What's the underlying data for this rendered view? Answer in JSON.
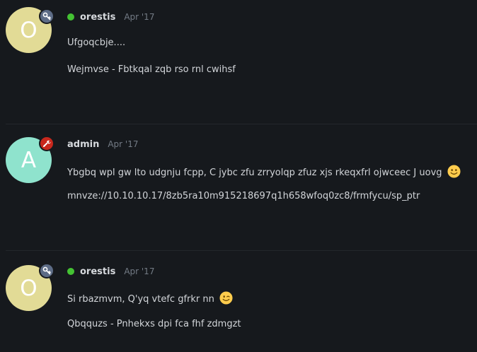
{
  "colors": {
    "background": "#16191d",
    "avatar_o": "#e2db96",
    "avatar_a": "#8fe3cd",
    "moderator_badge": "#5d6c86",
    "admin_badge": "#c8281d",
    "online": "#44c233"
  },
  "posts": [
    {
      "avatar_letter": "O",
      "avatar_color": "#e2db96",
      "badge_icon": "key-icon",
      "online": true,
      "username": "orestis",
      "date": "Apr '17",
      "lines": [
        "Ufgoqcbje....",
        "Wejmvse - Fbtkqal zqb rso rnl cwihsf"
      ]
    },
    {
      "avatar_letter": "A",
      "avatar_color": "#8fe3cd",
      "badge_icon": "wrench-icon",
      "online": false,
      "username": "admin",
      "date": "Apr '17",
      "lines": [
        "Ybgbq wpl gw lto udgnju fcpp, C jybc zfu zrryolqp zfuz xjs rkeqxfrl ojwceec J uovg",
        "mnvze://10.10.10.17/8zb5ra10m915218697q1h658wfoq0zc8/frmfycu/sp_ptr"
      ],
      "emoji": "slightly-smiling-face-icon"
    },
    {
      "avatar_letter": "O",
      "avatar_color": "#e2db96",
      "badge_icon": "key-icon",
      "online": true,
      "username": "orestis",
      "date": "Apr '17",
      "lines": [
        "Si rbazmvm, Q'yq vtefc gfrkr nn",
        "Qbqquzs - Pnhekxs dpi fca fhf zdmgzt"
      ],
      "emoji": "winking-face-icon"
    }
  ]
}
